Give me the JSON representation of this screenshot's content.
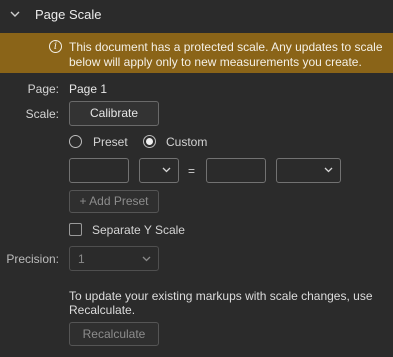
{
  "section": {
    "title": "Page Scale"
  },
  "banner": {
    "line1": "This document has a protected scale. Any updates to scale",
    "line2": "below will apply only to new measurements you create."
  },
  "page": {
    "label": "Page:",
    "value": "Page 1"
  },
  "scale": {
    "label": "Scale:",
    "calibrate_label": "Calibrate",
    "options": [
      {
        "label": "Preset",
        "checked": false
      },
      {
        "label": "Custom",
        "checked": true
      }
    ],
    "left_value": "",
    "left_unit": "",
    "equals": "=",
    "right_value": "",
    "right_unit": "",
    "add_preset_label": "+ Add Preset",
    "separate_y_label": "Separate Y Scale",
    "separate_y_checked": false
  },
  "precision": {
    "label": "Precision:",
    "value": "1"
  },
  "recalc": {
    "note_line1": "To update your existing markups with scale changes, use",
    "note_line2": "Recalculate.",
    "button_label": "Recalculate"
  }
}
